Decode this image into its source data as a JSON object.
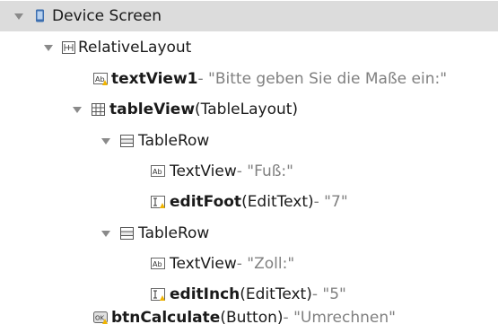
{
  "tree": {
    "device": {
      "label": "Device Screen"
    },
    "relativeLayout": {
      "label": "RelativeLayout"
    },
    "textView1": {
      "id": "textView1",
      "value": " - \"Bitte geben Sie die Maße ein:\""
    },
    "tableView": {
      "id": "tableView",
      "type": " (TableLayout)"
    },
    "row1": {
      "label": "TableRow",
      "textView": {
        "label": "TextView",
        "value": " - \"Fuß:\""
      },
      "edit": {
        "id": "editFoot",
        "type": " (EditText)",
        "value": " - \"7\""
      }
    },
    "row2": {
      "label": "TableRow",
      "textView": {
        "label": "TextView",
        "value": " - \"Zoll:\""
      },
      "edit": {
        "id": "editInch",
        "type": " (EditText)",
        "value": " - \"5\""
      }
    },
    "button": {
      "id": "btnCalculate",
      "type": " (Button)",
      "value": " - \"Umrechnen\""
    }
  },
  "colors": {
    "selection": "#dcdcdc",
    "muted_text": "#808080",
    "arrow": "#8a8a8a"
  },
  "icons": [
    "device-icon",
    "relative-layout-icon",
    "textview-icon",
    "table-layout-icon",
    "table-row-icon",
    "edittext-icon",
    "button-icon"
  ]
}
